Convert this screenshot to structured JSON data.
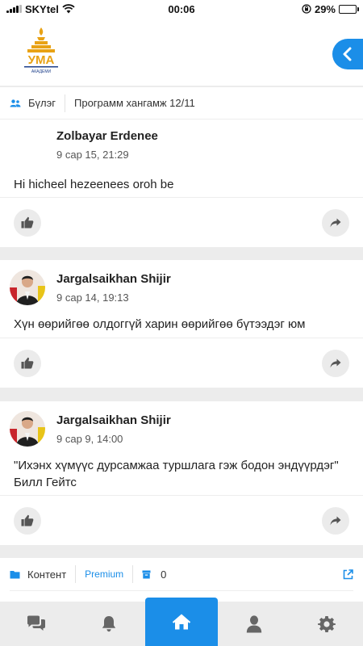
{
  "status_bar": {
    "carrier": "SKYtel",
    "time": "00:06",
    "battery": "29%",
    "battery_level": 0.29
  },
  "header": {
    "logo_text": "УМА",
    "logo_subtitle": "АКАДЕМИ"
  },
  "course_meta": {
    "group_label": "Бүлэг",
    "course_name": "Программ хангамж 12/11"
  },
  "posts": [
    {
      "author": "Zolbayar Erdenee",
      "date": "9 сар 15, 21:29",
      "text": "Hi hicheel hezeenees oroh be",
      "has_avatar": false
    },
    {
      "author": "Jargalsaikhan Shijir",
      "date": "9 сар 14, 19:13",
      "text": "Хүн өөрийгөө олдоггүй харин өөрийгөө бүтээдэг юм",
      "has_avatar": true
    },
    {
      "author": "Jargalsaikhan Shijir",
      "date": "9 сар 9, 14:00",
      "text": "\"Ихэнх хүмүүс дурсамжаа туршлага гэж бодон эндүүрдэг\" Билл Гейтс",
      "has_avatar": true
    }
  ],
  "content_bar": {
    "content_label": "Контент",
    "premium_label": "Premium",
    "count": "0"
  },
  "tabs": [
    {
      "icon": "chat-icon"
    },
    {
      "icon": "bell-icon"
    },
    {
      "icon": "home-icon",
      "active": true
    },
    {
      "icon": "user-icon"
    },
    {
      "icon": "gear-icon"
    }
  ],
  "colors": {
    "accent": "#1b8ee8",
    "background": "#ececec",
    "logo_gold": "#e8a215",
    "logo_blue": "#1d3f8a"
  }
}
